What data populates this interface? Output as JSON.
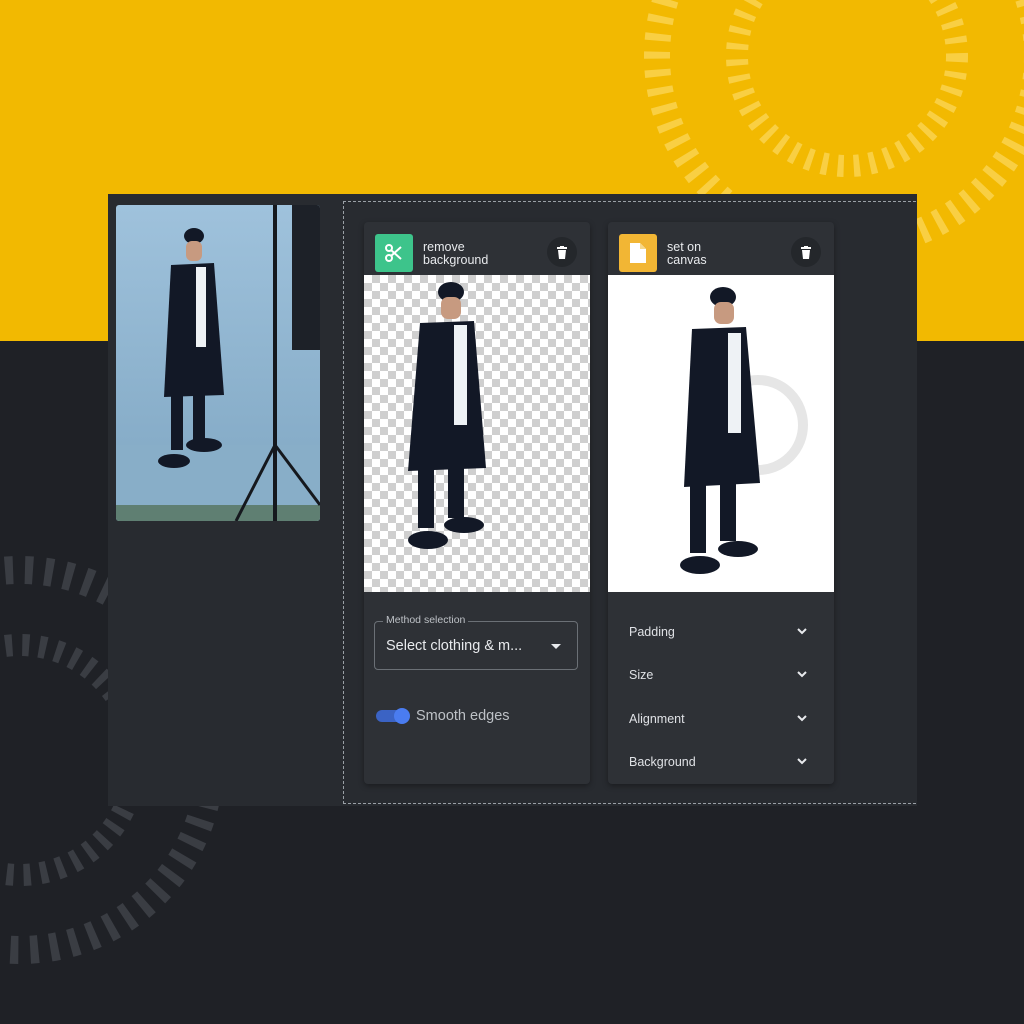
{
  "colors": {
    "accent_yellow": "#f2b901",
    "dark_bg": "#1f2126",
    "panel": "#2e3136",
    "green_icon": "#3dc48b",
    "yellow_icon": "#f2b634",
    "toggle_blue": "#4a7cf0"
  },
  "left_card": {
    "icon": "scissors-icon",
    "title_line1": "remove",
    "title_line2": "background",
    "method_label": "Method selection",
    "method_value": "Select clothing & m...",
    "toggle_label": "Smooth edges",
    "toggle_on": true
  },
  "right_card": {
    "icon": "document-icon",
    "title_line1": "set on",
    "title_line2": "canvas",
    "accordions": [
      {
        "label": "Padding"
      },
      {
        "label": "Size"
      },
      {
        "label": "Alignment"
      },
      {
        "label": "Background"
      }
    ]
  }
}
